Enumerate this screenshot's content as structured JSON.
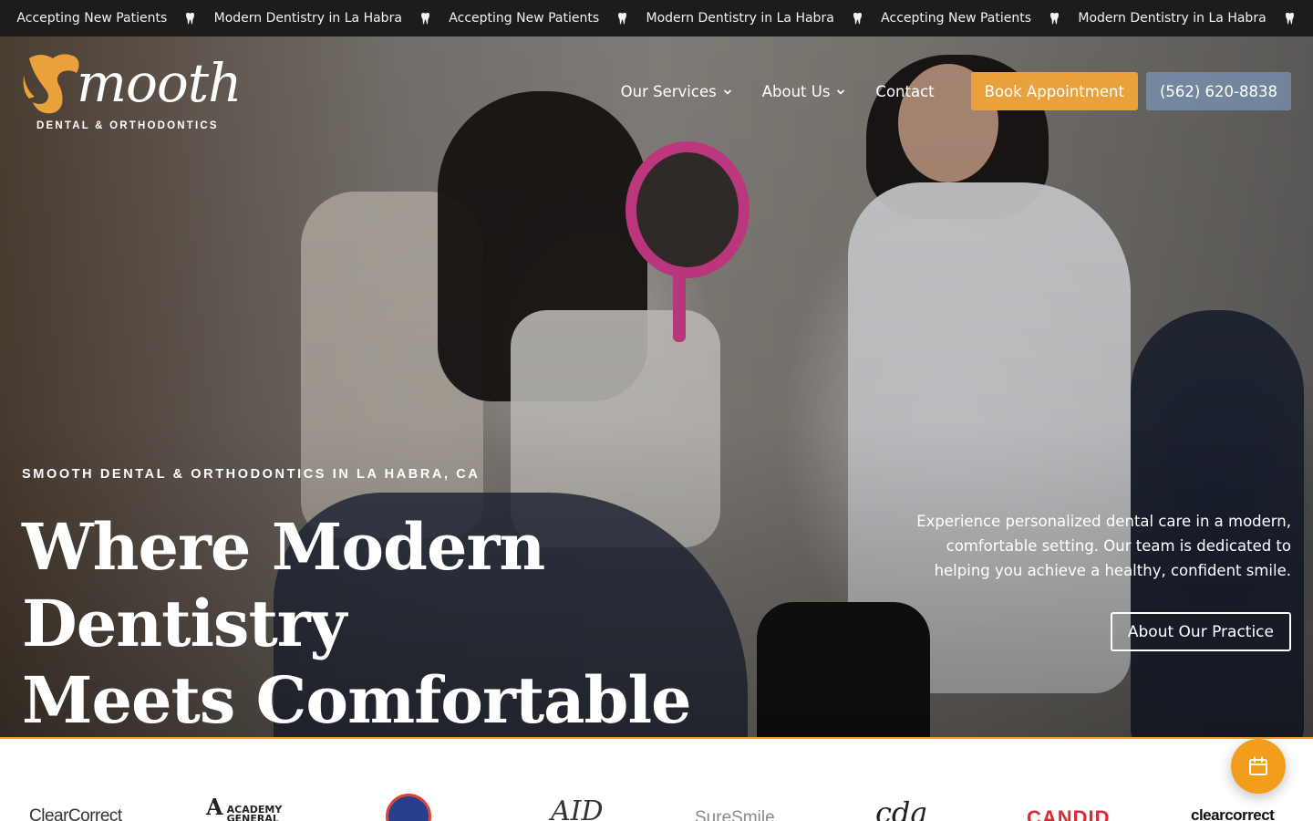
{
  "ticker": {
    "items": [
      "Accepting New Patients",
      "Modern Dentistry in La Habra",
      "Accepting New Patients",
      "Modern Dentistry in La Habra",
      "Accepting New Patients",
      "Modern Dentistry in La Habra"
    ],
    "separator_icon": "tooth-icon"
  },
  "brand": {
    "wordmark": "mooth",
    "subtitle": "DENTAL & ORTHODONTICS",
    "accent_color": "#e9a23b"
  },
  "nav": {
    "services": "Our Services",
    "about": "About Us",
    "contact": "Contact",
    "book": "Book Appointment",
    "phone": "(562) 620-8838"
  },
  "hero": {
    "eyebrow": "SMOOTH DENTAL & ORTHODONTICS IN LA HABRA, CA",
    "headline_line1": "Where Modern Dentistry",
    "headline_line2": "Meets Comfortable Care",
    "description": "Experience personalized dental care in a modern, comfortable setting. Our team is dedicated to helping you achieve a healthy, confident smile.",
    "cta": "About Our Practice"
  },
  "partners": {
    "clearcorrect": "ClearCorrect",
    "agd_line1": "ACADEMY",
    "agd_line2": "GENERAL",
    "aid": "AID",
    "suresmile": "SureSmile",
    "cda": "cda",
    "candid": "CANDID",
    "clearcorrect2": "clearcorrect"
  },
  "fab": {
    "icon": "calendar-icon",
    "color": "#f29d1c"
  }
}
